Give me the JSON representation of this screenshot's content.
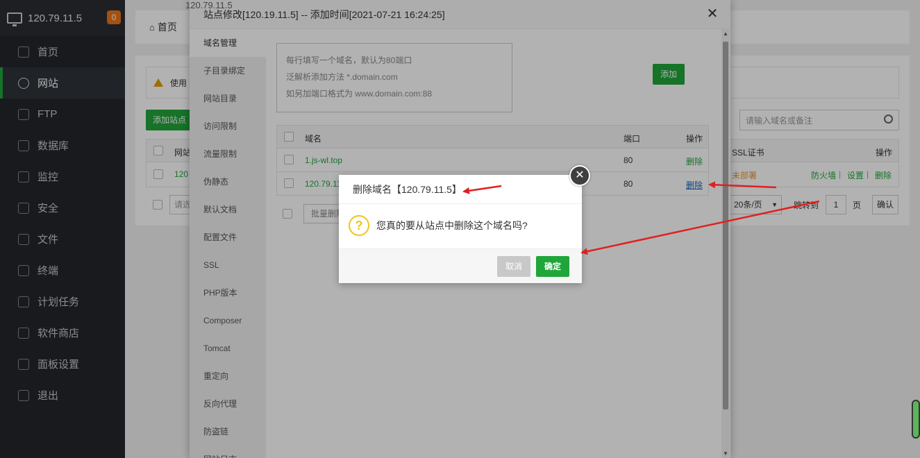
{
  "sidebar": {
    "server_ip": "120.79.11.5",
    "badge": "0",
    "items": [
      {
        "label": "首页",
        "icon": "home-icon"
      },
      {
        "label": "网站",
        "icon": "globe-icon"
      },
      {
        "label": "FTP",
        "icon": "ftp-icon"
      },
      {
        "label": "数据库",
        "icon": "database-icon"
      },
      {
        "label": "监控",
        "icon": "monitor-icon"
      },
      {
        "label": "安全",
        "icon": "shield-icon"
      },
      {
        "label": "文件",
        "icon": "folder-icon"
      },
      {
        "label": "终端",
        "icon": "terminal-icon"
      },
      {
        "label": "计划任务",
        "icon": "calendar-icon"
      },
      {
        "label": "软件商店",
        "icon": "apps-icon"
      },
      {
        "label": "面板设置",
        "icon": "gear-icon"
      },
      {
        "label": "退出",
        "icon": "logout-icon"
      }
    ]
  },
  "background": {
    "breadcrumb": "首页",
    "warning": "使用",
    "add_site": "添加站点",
    "search_placeholder": "请输入域名或备注",
    "col_site": "网站",
    "col_ssl": "SSL证书",
    "col_ops": "操作",
    "row_site": "120",
    "row_ssl": "未部署",
    "row_firewall": "防火墙",
    "row_settings": "设置",
    "row_delete": "删除",
    "sep": "|",
    "select_placeholder": "请选",
    "page_size": "20条/页",
    "jump_to": "跳转到",
    "page_num": "1",
    "page_unit": "页",
    "confirm": "确认"
  },
  "modal": {
    "ghost_ip": "120.79.11.5",
    "title": "站点修改[120.19.11.5] -- 添加时间[2021-07-21 16:24:25]",
    "tabs": [
      "域名管理",
      "子目录绑定",
      "网站目录",
      "访问限制",
      "流量限制",
      "伪静态",
      "默认文档",
      "配置文件",
      "SSL",
      "PHP版本",
      "Composer",
      "Tomcat",
      "重定向",
      "反向代理",
      "防盗链",
      "网站日志"
    ],
    "textarea_lines": [
      "每行填写一个域名，默认为80端口",
      "泛解析添加方法 *.domain.com",
      "如另加端口格式为 www.domain.com:88"
    ],
    "add_button": "添加",
    "table": {
      "headers": [
        "域名",
        "端口",
        "操作"
      ],
      "rows": [
        {
          "domain": "1.js-wl.top",
          "port": "80",
          "action": "删除"
        },
        {
          "domain": "120.79.11.5",
          "port": "80",
          "action": "删除"
        }
      ]
    },
    "batch_delete": "批量删除"
  },
  "confirm": {
    "title": "删除域名【120.79.11.5】",
    "message": "您真的要从站点中删除这个域名吗?",
    "cancel": "取消",
    "ok": "确定"
  },
  "colors": {
    "accent": "#20a53a",
    "sidebar_bg": "#23262c",
    "arrow": "#e02020",
    "question": "#f0c419"
  }
}
